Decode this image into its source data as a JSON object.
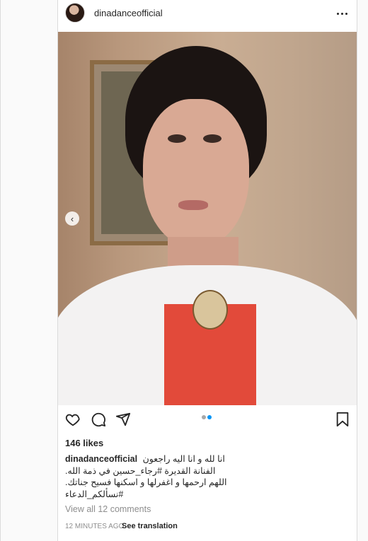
{
  "post": {
    "username": "dinadanceofficial",
    "likes": "146 likes",
    "caption": {
      "username": "dinadanceofficial",
      "line1": "انا لله و انا اليه راجعون",
      "line2": "الفنانة القديرة #رجاء_حسين في ذمة الله.",
      "line3": "اللهم ارحمها و اغفرلها و اسكنها فسيح جناتك.",
      "line4": "#نسألكم_الدعاء"
    },
    "view_comments": "View all 12 comments",
    "time_ago": "12 MINUTES AGO",
    "see_translation": "See translation"
  },
  "carousel": {
    "slide_count": 2,
    "active_index": 1
  },
  "icons": {
    "more": "more-options-icon",
    "prev": "chevron-left-icon",
    "like": "heart-icon",
    "comment": "comment-icon",
    "share": "send-icon",
    "save": "bookmark-icon"
  },
  "colors": {
    "active_dot": "#0095f6",
    "inactive_dot": "#a8a8a8",
    "muted_text": "#8e8e8e"
  }
}
